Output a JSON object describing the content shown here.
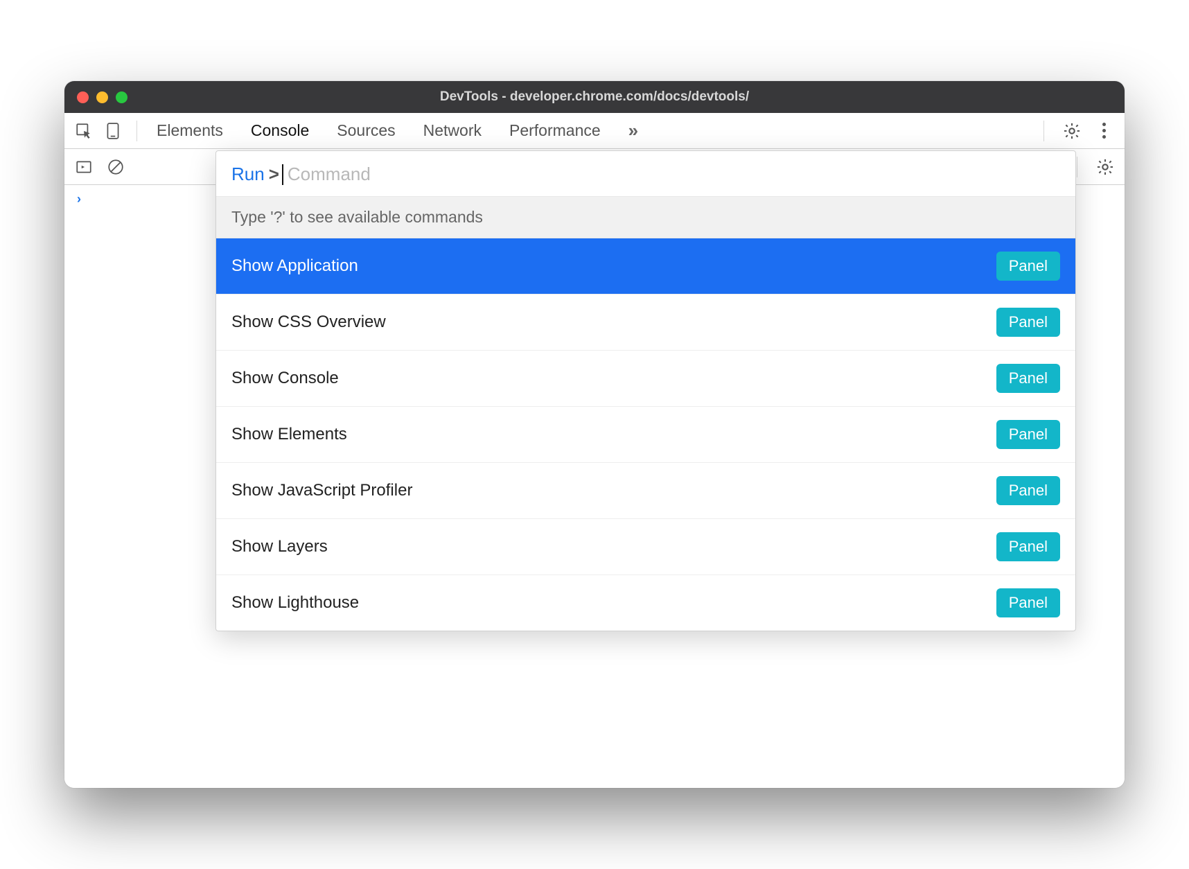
{
  "window": {
    "title": "DevTools - developer.chrome.com/docs/devtools/"
  },
  "toolbar": {
    "tabs": [
      {
        "label": "Elements",
        "active": false
      },
      {
        "label": "Console",
        "active": true
      },
      {
        "label": "Sources",
        "active": false
      },
      {
        "label": "Network",
        "active": false
      },
      {
        "label": "Performance",
        "active": false
      }
    ]
  },
  "command_menu": {
    "prefix": "Run",
    "prompt_char": ">",
    "placeholder": "Command",
    "hint": "Type '?' to see available commands",
    "items": [
      {
        "label": "Show Application",
        "badge": "Panel",
        "selected": true
      },
      {
        "label": "Show CSS Overview",
        "badge": "Panel",
        "selected": false
      },
      {
        "label": "Show Console",
        "badge": "Panel",
        "selected": false
      },
      {
        "label": "Show Elements",
        "badge": "Panel",
        "selected": false
      },
      {
        "label": "Show JavaScript Profiler",
        "badge": "Panel",
        "selected": false
      },
      {
        "label": "Show Layers",
        "badge": "Panel",
        "selected": false
      },
      {
        "label": "Show Lighthouse",
        "badge": "Panel",
        "selected": false
      }
    ]
  }
}
